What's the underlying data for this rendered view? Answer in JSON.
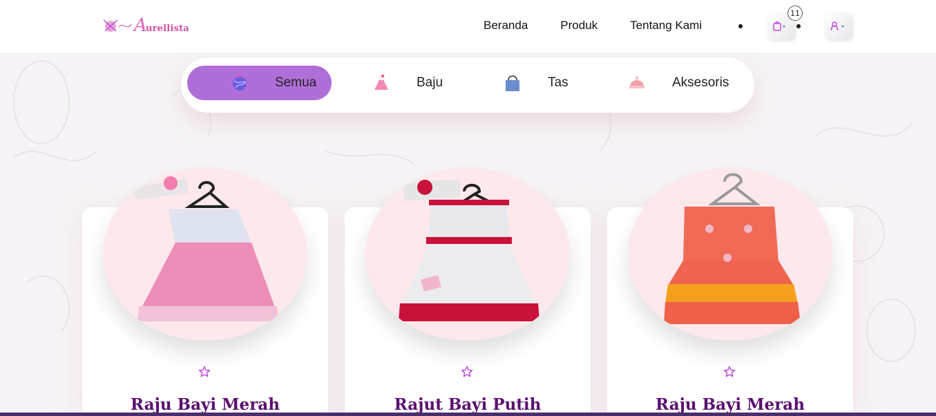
{
  "header": {
    "logo_text": "urellista",
    "logo_initial": "A",
    "nav": [
      "Beranda",
      "Produk",
      "Tentang Kami"
    ],
    "cart_count": "11",
    "icons": [
      "cart-icon",
      "user-icon",
      "chevron-down-icon"
    ]
  },
  "categories": [
    {
      "label": "Semua",
      "icon": "yarn-ball-icon",
      "active": true
    },
    {
      "label": "Baju",
      "icon": "dress-icon",
      "active": false
    },
    {
      "label": "Tas",
      "icon": "bag-icon",
      "active": false
    },
    {
      "label": "Aksesoris",
      "icon": "hat-icon",
      "active": false
    }
  ],
  "products": [
    {
      "title": "Raju Bayi Merah"
    },
    {
      "title": "Rajut Bayi Putih"
    },
    {
      "title": "Raju Bayi Merah"
    }
  ],
  "colors": {
    "accent": "#b06fd8",
    "title": "#5a0f6e",
    "circle": "#fde8eb",
    "star": "#c04ad8"
  }
}
